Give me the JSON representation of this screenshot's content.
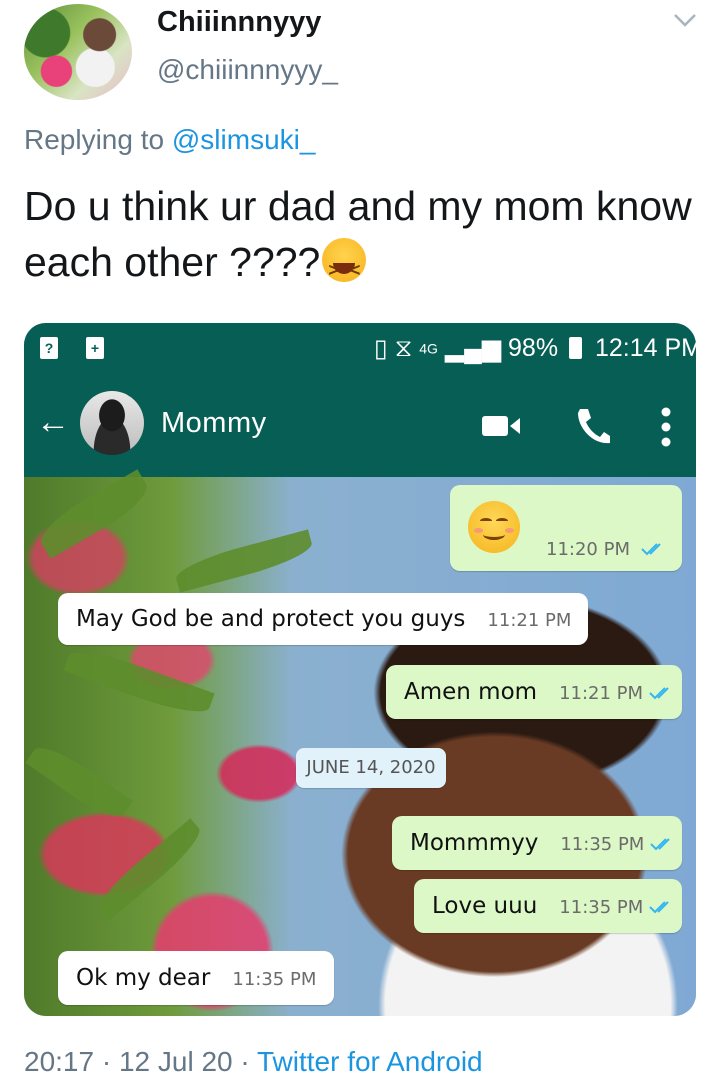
{
  "tweet": {
    "display_name": "Chiiinnnyyy",
    "handle": "@chiiinnnyyy_",
    "replying_prefix": "Replying to ",
    "replying_to": "@slimsuki_",
    "text": "Do u think ur dad and my mom know each other ????",
    "emoji": "laughing-squinting-emoji",
    "timestamp": "20:17 · 12 Jul 20 · ",
    "source": "Twitter for Android"
  },
  "phone": {
    "status_bar": {
      "network": "4G",
      "battery": "98%",
      "time": "12:14 PM"
    },
    "chat": {
      "contact_name": "Mommy",
      "messages": [
        {
          "direction": "outgoing",
          "emoji": "smiling-face-emoji",
          "time": "11:20 PM",
          "read": true
        },
        {
          "direction": "incoming",
          "text": "May God be and protect you guys",
          "time": "11:21 PM"
        },
        {
          "direction": "outgoing",
          "text": "Amen mom",
          "time": "11:21 PM",
          "read": true
        },
        {
          "direction": "outgoing",
          "text": "Mommmyy",
          "time": "11:35 PM",
          "read": true
        },
        {
          "direction": "outgoing",
          "text": "Love uuu",
          "time": "11:35 PM",
          "read": true
        },
        {
          "direction": "incoming",
          "text": "Ok my dear",
          "time": "11:35 PM"
        }
      ],
      "date_divider": "JUNE 14, 2020",
      "colors": {
        "header": "#075e54",
        "outgoing_bubble": "#dcf8c6",
        "incoming_bubble": "#ffffff",
        "read_ticks": "#34b7f1"
      }
    }
  },
  "colors": {
    "link": "#1b95e0",
    "muted": "#657786"
  }
}
